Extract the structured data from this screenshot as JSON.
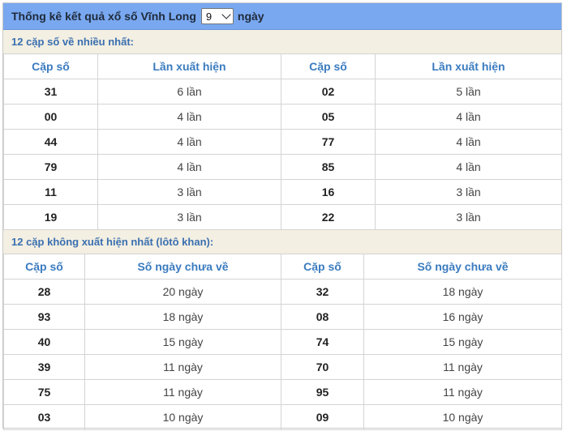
{
  "header": {
    "prefix": "Thống kê kết quả xổ số Vĩnh Long",
    "select_value": "9",
    "suffix": "ngày"
  },
  "section1": {
    "title": "12 cặp số về nhiều nhất:",
    "columns": [
      "Cặp số",
      "Lần xuất hiện",
      "Cặp số",
      "Lần xuất hiện"
    ],
    "rows": [
      [
        "31",
        "6 lần",
        "02",
        "5 lần"
      ],
      [
        "00",
        "4 lần",
        "05",
        "4 lần"
      ],
      [
        "44",
        "4 lần",
        "77",
        "4 lần"
      ],
      [
        "79",
        "4 lần",
        "85",
        "4 lần"
      ],
      [
        "11",
        "3 lần",
        "16",
        "3 lần"
      ],
      [
        "19",
        "3 lần",
        "22",
        "3 lần"
      ]
    ]
  },
  "section2": {
    "title": "12 cặp không xuất hiện nhất (lôtô khan):",
    "columns": [
      "Cặp số",
      "Số ngày chưa về",
      "Cặp số",
      "Số ngày chưa về"
    ],
    "rows": [
      [
        "28",
        "20 ngày",
        "32",
        "18 ngày"
      ],
      [
        "93",
        "18 ngày",
        "08",
        "16 ngày"
      ],
      [
        "40",
        "15 ngày",
        "74",
        "15 ngày"
      ],
      [
        "39",
        "11 ngày",
        "70",
        "11 ngày"
      ],
      [
        "75",
        "11 ngày",
        "95",
        "11 ngày"
      ],
      [
        "03",
        "10 ngày",
        "09",
        "10 ngày"
      ]
    ]
  }
}
